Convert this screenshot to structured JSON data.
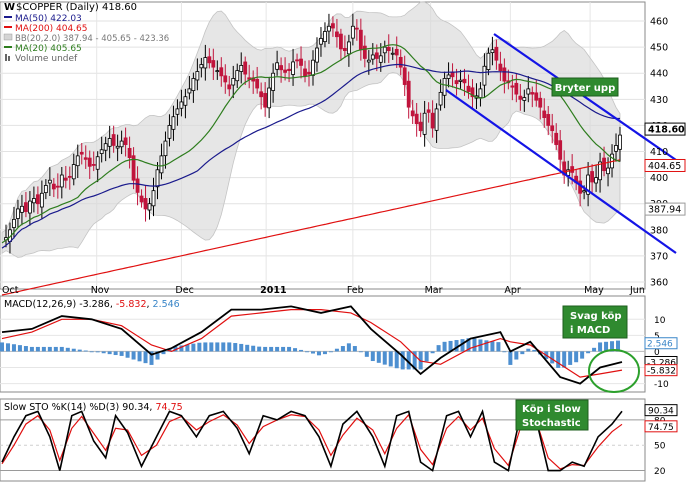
{
  "chart_data": [
    {
      "type": "candlestick",
      "panel": "price",
      "title": "$COPPER (Daily) 418.60",
      "symbol": "$COPPER",
      "last": 418.6,
      "ylim": [
        360,
        465
      ],
      "y_ticks": [
        360,
        370,
        380,
        390,
        400,
        410,
        420,
        430,
        440,
        450,
        460
      ],
      "x_labels": [
        "Oct",
        "Nov",
        "Dec",
        "2011",
        "Feb",
        "Mar",
        "Apr",
        "May",
        "Jun"
      ],
      "legend": [
        {
          "label": "MA(50)",
          "value": "422.03",
          "color": "#1a1a8c"
        },
        {
          "label": "MA(200)",
          "value": "404.65",
          "color": "#e01010"
        },
        {
          "label": "BB(20,2.0)",
          "value": "387.94 - 405.65 - 423.36",
          "color": "#999999"
        },
        {
          "label": "MA(20)",
          "value": "405.65",
          "color": "#2e7d1e"
        },
        {
          "label": "Volume",
          "value": "undef",
          "color": "#666666"
        }
      ],
      "value_labels": [
        "418.60",
        "404.65",
        "387.94"
      ],
      "annotation": "Bryter upp",
      "channel_lines": [
        {
          "from": [
            "Apr 20",
            452
          ],
          "to": [
            "Jun 15",
            396
          ]
        },
        {
          "from": [
            "Mar 31",
            437
          ],
          "to": [
            "Jun 15",
            372
          ]
        }
      ],
      "price_path": [
        [
          0,
          375
        ],
        [
          6,
          378
        ],
        [
          12,
          384
        ],
        [
          18,
          390
        ],
        [
          24,
          387
        ],
        [
          30,
          393
        ],
        [
          36,
          390
        ],
        [
          42,
          396
        ],
        [
          48,
          399
        ],
        [
          54,
          394
        ],
        [
          60,
          401
        ],
        [
          66,
          398
        ],
        [
          72,
          405
        ],
        [
          78,
          410
        ],
        [
          84,
          407
        ],
        [
          90,
          403
        ],
        [
          96,
          408
        ],
        [
          102,
          412
        ],
        [
          108,
          415
        ],
        [
          114,
          411
        ],
        [
          120,
          414
        ],
        [
          126,
          412
        ],
        [
          132,
          399
        ],
        [
          138,
          392
        ],
        [
          144,
          388
        ],
        [
          150,
          391
        ],
        [
          156,
          403
        ],
        [
          162,
          411
        ],
        [
          168,
          420
        ],
        [
          174,
          425
        ],
        [
          180,
          429
        ],
        [
          186,
          432
        ],
        [
          192,
          438
        ],
        [
          198,
          442
        ],
        [
          204,
          446
        ],
        [
          210,
          443
        ],
        [
          216,
          441
        ],
        [
          222,
          438
        ],
        [
          228,
          434
        ],
        [
          234,
          440
        ],
        [
          240,
          443
        ],
        [
          246,
          438
        ],
        [
          252,
          437
        ],
        [
          258,
          433
        ],
        [
          264,
          427
        ],
        [
          270,
          438
        ],
        [
          276,
          444
        ],
        [
          282,
          440
        ],
        [
          288,
          441
        ],
        [
          294,
          446
        ],
        [
          300,
          443
        ],
        [
          306,
          437
        ],
        [
          312,
          445
        ],
        [
          318,
          452
        ],
        [
          324,
          456
        ],
        [
          330,
          459
        ],
        [
          336,
          454
        ],
        [
          342,
          447
        ],
        [
          348,
          452
        ],
        [
          354,
          461
        ],
        [
          360,
          449
        ],
        [
          366,
          444
        ],
        [
          372,
          447
        ],
        [
          378,
          445
        ],
        [
          384,
          450
        ],
        [
          390,
          448
        ],
        [
          396,
          447
        ],
        [
          402,
          440
        ],
        [
          408,
          427
        ],
        [
          414,
          422
        ],
        [
          420,
          418
        ],
        [
          426,
          428
        ],
        [
          432,
          419
        ],
        [
          438,
          430
        ],
        [
          444,
          438
        ],
        [
          450,
          440
        ],
        [
          456,
          436
        ],
        [
          462,
          438
        ],
        [
          468,
          433
        ],
        [
          474,
          430
        ],
        [
          480,
          434
        ],
        [
          486,
          447
        ],
        [
          492,
          449
        ],
        [
          498,
          443
        ],
        [
          504,
          437
        ],
        [
          510,
          436
        ],
        [
          516,
          432
        ],
        [
          522,
          429
        ],
        [
          528,
          434
        ],
        [
          534,
          431
        ],
        [
          540,
          427
        ],
        [
          546,
          421
        ],
        [
          552,
          418
        ],
        [
          558,
          410
        ],
        [
          564,
          401
        ],
        [
          570,
          404
        ],
        [
          576,
          398
        ],
        [
          582,
          392
        ],
        [
          588,
          401
        ],
        [
          594,
          397
        ],
        [
          600,
          406
        ],
        [
          606,
          401
        ],
        [
          612,
          409
        ],
        [
          618,
          414
        ],
        [
          622,
          418.6
        ]
      ]
    },
    {
      "type": "line",
      "panel": "macd",
      "title": "MACD(12,26,9) -3.286, -5.832, 2.546",
      "parts": {
        "name": "MACD(12,26,9)",
        "macd": "-3.286",
        "signal": "-5.832",
        "hist": "2.546"
      },
      "ylim": [
        -12,
        16
      ],
      "y_ticks": [
        -10,
        -5,
        0,
        5,
        10
      ],
      "value_labels": [
        "2.546",
        "-3.286",
        "-5.832"
      ],
      "annotation": [
        "Svag köp",
        "i MACD"
      ],
      "macd": [
        [
          0,
          6
        ],
        [
          30,
          7
        ],
        [
          60,
          11
        ],
        [
          90,
          10
        ],
        [
          120,
          7
        ],
        [
          150,
          -1
        ],
        [
          170,
          1
        ],
        [
          200,
          6
        ],
        [
          230,
          13
        ],
        [
          260,
          13
        ],
        [
          290,
          14
        ],
        [
          320,
          12
        ],
        [
          350,
          14
        ],
        [
          370,
          7
        ],
        [
          400,
          -1
        ],
        [
          420,
          -7
        ],
        [
          440,
          -2
        ],
        [
          470,
          4
        ],
        [
          500,
          6
        ],
        [
          510,
          0
        ],
        [
          530,
          3
        ],
        [
          560,
          -8
        ],
        [
          580,
          -10
        ],
        [
          600,
          -5
        ],
        [
          622,
          -3.3
        ]
      ],
      "signal": [
        [
          0,
          4
        ],
        [
          30,
          6
        ],
        [
          60,
          10
        ],
        [
          90,
          10
        ],
        [
          120,
          8
        ],
        [
          150,
          2
        ],
        [
          170,
          0
        ],
        [
          200,
          4
        ],
        [
          230,
          11
        ],
        [
          260,
          12
        ],
        [
          290,
          13
        ],
        [
          320,
          13
        ],
        [
          350,
          12
        ],
        [
          370,
          9
        ],
        [
          400,
          3
        ],
        [
          420,
          -3
        ],
        [
          440,
          -4
        ],
        [
          470,
          1
        ],
        [
          500,
          4
        ],
        [
          510,
          3
        ],
        [
          530,
          2
        ],
        [
          560,
          -4
        ],
        [
          580,
          -8
        ],
        [
          600,
          -7
        ],
        [
          622,
          -5.8
        ]
      ]
    },
    {
      "type": "line",
      "panel": "stochastic",
      "title": "Slow STO %K(14) %D(3) 90.34, 74.75",
      "parts": {
        "name": "Slow STO %K(14) %D(3)",
        "k": "90.34",
        "d": "74.75"
      },
      "ylim": [
        10,
        100
      ],
      "y_ticks": [
        20,
        50,
        80
      ],
      "value_labels": [
        "90.34",
        "74.75"
      ],
      "annotation": [
        "Köp i Slow",
        "Stochastic"
      ],
      "k": [
        [
          0,
          30
        ],
        [
          12,
          60
        ],
        [
          24,
          85
        ],
        [
          36,
          90
        ],
        [
          48,
          60
        ],
        [
          58,
          20
        ],
        [
          70,
          85
        ],
        [
          80,
          90
        ],
        [
          92,
          55
        ],
        [
          104,
          35
        ],
        [
          114,
          85
        ],
        [
          126,
          65
        ],
        [
          140,
          25
        ],
        [
          155,
          60
        ],
        [
          168,
          90
        ],
        [
          180,
          85
        ],
        [
          195,
          60
        ],
        [
          208,
          85
        ],
        [
          222,
          90
        ],
        [
          236,
          70
        ],
        [
          248,
          40
        ],
        [
          262,
          85
        ],
        [
          276,
          80
        ],
        [
          290,
          90
        ],
        [
          304,
          85
        ],
        [
          318,
          60
        ],
        [
          330,
          25
        ],
        [
          342,
          75
        ],
        [
          356,
          90
        ],
        [
          372,
          60
        ],
        [
          384,
          25
        ],
        [
          396,
          85
        ],
        [
          408,
          90
        ],
        [
          420,
          30
        ],
        [
          432,
          20
        ],
        [
          446,
          85
        ],
        [
          458,
          90
        ],
        [
          470,
          60
        ],
        [
          482,
          90
        ],
        [
          494,
          30
        ],
        [
          508,
          20
        ],
        [
          520,
          85
        ],
        [
          534,
          90
        ],
        [
          548,
          20
        ],
        [
          560,
          20
        ],
        [
          572,
          30
        ],
        [
          584,
          25
        ],
        [
          598,
          60
        ],
        [
          612,
          75
        ],
        [
          622,
          90.3
        ]
      ],
      "d": [
        [
          0,
          28
        ],
        [
          12,
          50
        ],
        [
          24,
          75
        ],
        [
          36,
          85
        ],
        [
          48,
          68
        ],
        [
          58,
          32
        ],
        [
          70,
          70
        ],
        [
          80,
          84
        ],
        [
          92,
          64
        ],
        [
          104,
          44
        ],
        [
          114,
          70
        ],
        [
          126,
          68
        ],
        [
          140,
          38
        ],
        [
          155,
          50
        ],
        [
          168,
          78
        ],
        [
          180,
          84
        ],
        [
          195,
          68
        ],
        [
          208,
          78
        ],
        [
          222,
          86
        ],
        [
          236,
          74
        ],
        [
          248,
          52
        ],
        [
          262,
          72
        ],
        [
          276,
          80
        ],
        [
          290,
          86
        ],
        [
          304,
          84
        ],
        [
          318,
          68
        ],
        [
          330,
          38
        ],
        [
          342,
          62
        ],
        [
          356,
          82
        ],
        [
          372,
          68
        ],
        [
          384,
          40
        ],
        [
          396,
          70
        ],
        [
          408,
          86
        ],
        [
          420,
          45
        ],
        [
          432,
          27
        ],
        [
          446,
          70
        ],
        [
          458,
          84
        ],
        [
          470,
          68
        ],
        [
          482,
          82
        ],
        [
          494,
          46
        ],
        [
          508,
          26
        ],
        [
          520,
          70
        ],
        [
          534,
          86
        ],
        [
          548,
          35
        ],
        [
          560,
          22
        ],
        [
          572,
          27
        ],
        [
          584,
          26
        ],
        [
          598,
          48
        ],
        [
          612,
          66
        ],
        [
          622,
          74.8
        ]
      ]
    }
  ]
}
